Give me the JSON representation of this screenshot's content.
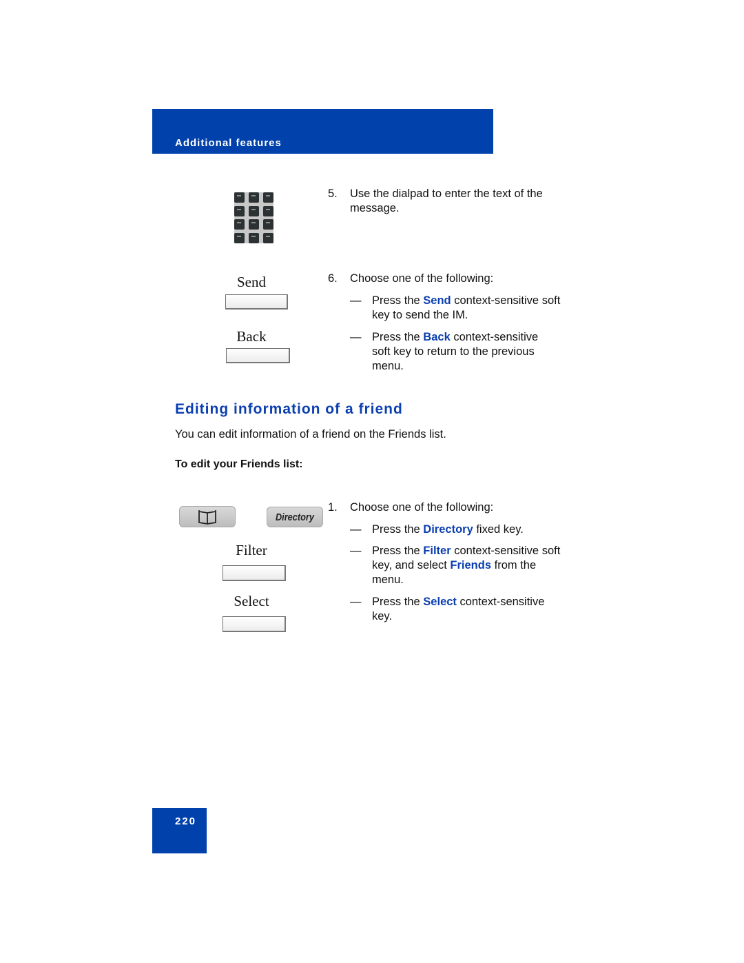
{
  "header": {
    "section": "Additional features"
  },
  "steps_top": {
    "step5": {
      "number": "5.",
      "text": "Use the dialpad to enter the text of the message."
    },
    "step6": {
      "number": "6.",
      "text": "Choose one of the following:",
      "options": [
        {
          "dash": "—",
          "pre": "Press the ",
          "key": "Send",
          "post": " context-sensitive soft key to send the IM."
        },
        {
          "dash": "—",
          "pre": "Press the ",
          "key": "Back",
          "post": " context-sensitive soft key to return to the previous menu."
        }
      ]
    }
  },
  "illustrations_top": {
    "dialpad_icon": "dialpad-icon",
    "softkeys": [
      {
        "label": "Send"
      },
      {
        "label": "Back"
      }
    ]
  },
  "section": {
    "title": "Editing information of a friend",
    "intro": "You can edit information of a friend on the Friends list.",
    "procedure_title": "To edit your Friends list:"
  },
  "steps_bottom": {
    "step1": {
      "number": "1.",
      "text": "Choose one of the following:",
      "options": [
        {
          "dash": "—",
          "pre": "Press the ",
          "key": "Directory",
          "post": " fixed key."
        },
        {
          "dash": "—",
          "pre": "Press the ",
          "key": "Filter",
          "post": " context-sensitive soft key, and select ",
          "key2": "Friends",
          "post2": " from the menu."
        },
        {
          "dash": "—",
          "pre": "Press the ",
          "key": "Select",
          "post": " context-sensitive key."
        }
      ]
    }
  },
  "illustrations_bottom": {
    "book_key_icon": "book-icon",
    "directory_key_label": "Directory",
    "softkeys": [
      {
        "label": "Filter"
      },
      {
        "label": "Select"
      }
    ]
  },
  "footer": {
    "page_number": "220"
  },
  "colors": {
    "brand_blue": "#0041ac",
    "keyword_blue": "#0b3fb0"
  }
}
